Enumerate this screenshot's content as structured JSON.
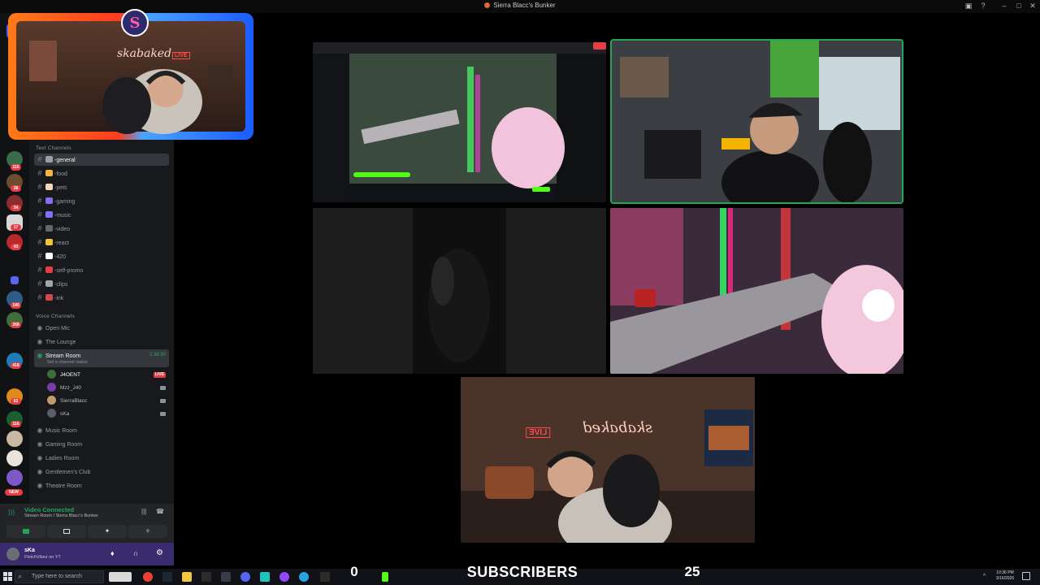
{
  "window": {
    "title": "Sierra Blacc's Bunker"
  },
  "rail": {
    "badges": [
      "116",
      "28",
      "34",
      "17",
      "43",
      "140",
      "268",
      "418",
      "116",
      "63",
      "NEW"
    ]
  },
  "sidebar": {
    "text_category": "Text Channels",
    "text_channels": [
      {
        "name": "-general",
        "color": "#9b9ea4"
      },
      {
        "name": "-food",
        "color": "#f5b53a"
      },
      {
        "name": "-pets",
        "color": "#f4d6b9"
      },
      {
        "name": "-gaming",
        "color": "#8a6cf0"
      },
      {
        "name": "-music",
        "color": "#7e73f5"
      },
      {
        "name": "-video",
        "color": "#63666c"
      },
      {
        "name": "-react",
        "color": "#f2c23b"
      },
      {
        "name": "-420",
        "color": "#ffffff"
      },
      {
        "name": "-self-promo",
        "color": "#e53e45"
      },
      {
        "name": "-clips",
        "color": "#9fa3aa"
      },
      {
        "name": "-ink",
        "color": "#d14b4b"
      }
    ],
    "voice_category": "Voice Channels",
    "voice_channels_top": [
      "Open Mic",
      "The Lounge"
    ],
    "stream_room": {
      "name": "Stream Room",
      "timer": "2:38:30",
      "status": "Set a channel status"
    },
    "voice_users": [
      {
        "name": "J4OENT",
        "live": "LIVE"
      },
      {
        "name": "Mzz_J40",
        "live": ""
      },
      {
        "name": "SierraBlacc",
        "live": ""
      },
      {
        "name": "sKa",
        "live": ""
      }
    ],
    "voice_channels_bottom": [
      "Music Room",
      "Gaming Room",
      "Ladies Room",
      "Gentlemen's Club",
      "Theatre Room"
    ]
  },
  "voice_panel": {
    "status": "Video Connected",
    "location": "Stream Room / Sierra Blacc's Bunker"
  },
  "user_panel": {
    "username": "sKa",
    "status": "FletchVibez on YT"
  },
  "overlay": {
    "brand_text": "skabaked",
    "live_text": "LIVE"
  },
  "tiles": {
    "tile5_sign": "skabaked",
    "tile5_live": "LIVE"
  },
  "ticker": {
    "count": "0",
    "label": "SUBSCRIBERS",
    "goal": "25"
  },
  "taskbar": {
    "search_placeholder": "Type here to search",
    "time": "10:36 PM",
    "date": "3/16/2026"
  }
}
